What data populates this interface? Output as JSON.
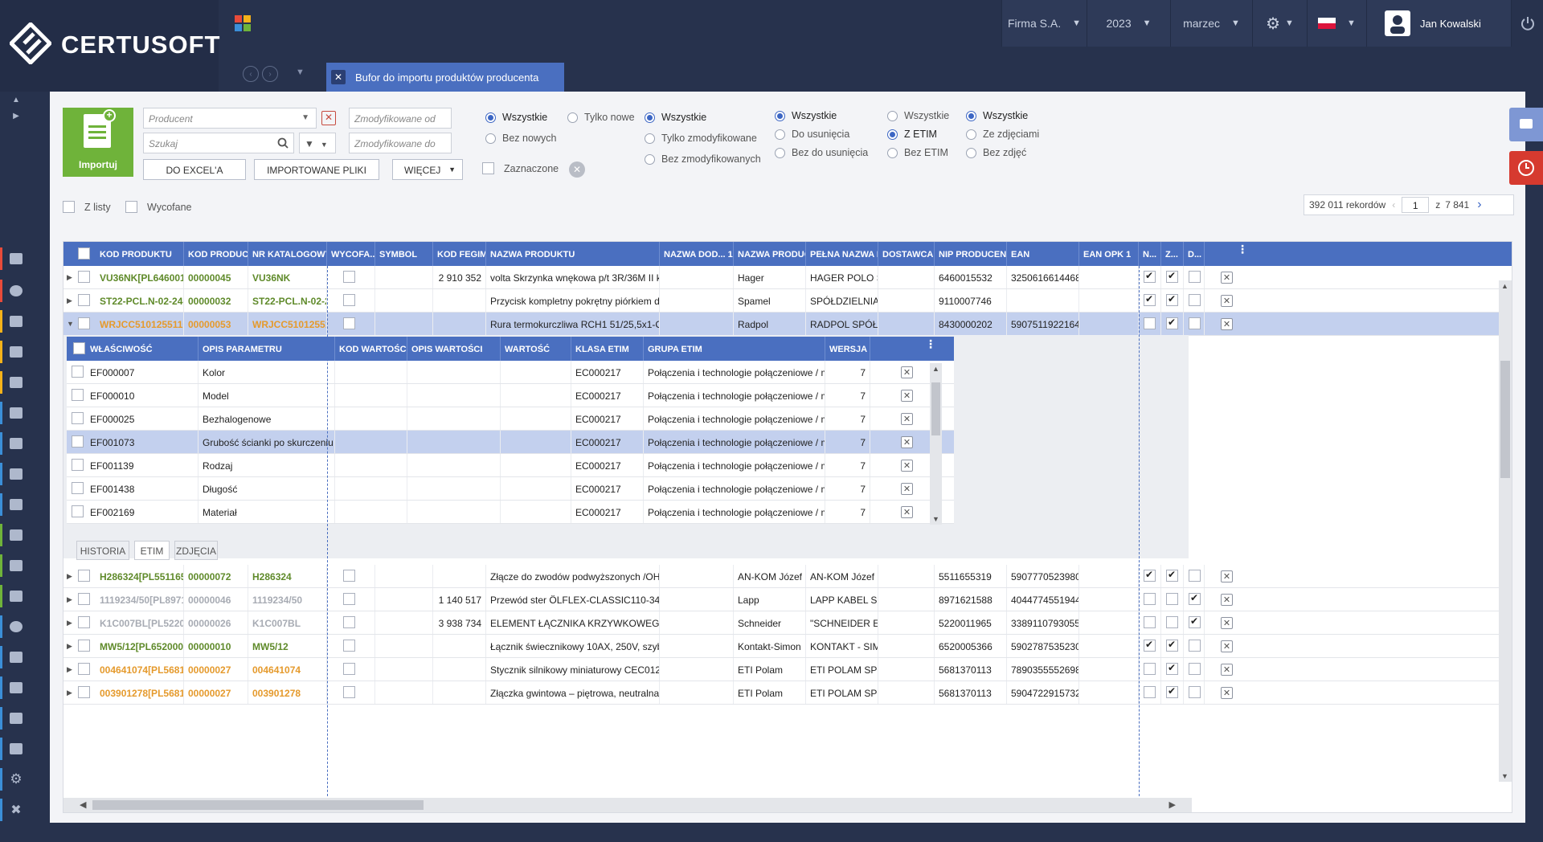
{
  "app": {
    "brand": "CERTUSOFT"
  },
  "topbar": {
    "company": "Firma S.A.",
    "year": "2023",
    "month": "marzec",
    "user": "Jan Kowalski"
  },
  "tab": {
    "title": "Bufor do importu produktów producenta"
  },
  "filters": {
    "import_label": "Importuj",
    "producer_placeholder": "Producent",
    "search_placeholder": "Szukaj",
    "modified_from_placeholder": "Zmodyfikowane od",
    "modified_to_placeholder": "Zmodyfikowane do",
    "btn_excel": "DO EXCEL'A",
    "btn_imported": "IMPORTOWANE PLIKI",
    "btn_more": "WIĘCEJ",
    "chk_marked": "Zaznaczone",
    "chk_from_list": "Z listy",
    "chk_withdrawn": "Wycofane",
    "group1": [
      "Wszystkie",
      "Bez nowych",
      "Tylko nowe"
    ],
    "group2": [
      "Wszystkie",
      "Tylko zmodyfikowane",
      "Bez zmodyfikowanych"
    ],
    "group3": [
      "Wszystkie",
      "Do usunięcia",
      "Bez do usunięcia"
    ],
    "group4": [
      "Wszystkie",
      "Z ETIM",
      "Bez ETIM"
    ],
    "group5": [
      "Wszystkie",
      "Ze zdjęciami",
      "Bez zdjęć"
    ]
  },
  "pager": {
    "records": "392 011 rekordów",
    "page": "1",
    "of": "z",
    "total": "7 841"
  },
  "grid": {
    "columns": [
      "KOD PRODUKTU",
      "KOD PRODUC...",
      "NR KATALOGOWY",
      "WYCOFA...",
      "SYMBOL",
      "KOD FEGIME",
      "NAZWA PRODUKTU",
      "NAZWA DOD... 1↑",
      "NAZWA PRODUC...",
      "PEŁNA NAZWA P...",
      "DOSTAWCA",
      "NIP PRODUCENTA",
      "EAN",
      "EAN OPK 1",
      "N...",
      "Z...",
      "D..."
    ],
    "rows_top": [
      {
        "kod": "VU36NK[PL6460015...",
        "kp": "00000045",
        "nr": "VU36NK",
        "fegime": "2 910 352",
        "nazwa": "volta Skrzynka wnękowa p/t 3R/36M II kl I...",
        "prod": "Hager",
        "pelna": "HAGER POLO S...",
        "nip": "6460015532",
        "ean": "3250616614468",
        "color": "green",
        "n": true,
        "z": true,
        "d": false
      },
      {
        "kod": "ST22-PCL.N-02-24-L...",
        "kp": "00000032",
        "nr": "ST22-PCL.N-02-2...",
        "fegime": "",
        "nazwa": "Przycisk kompletny pokrętny piórkiem dw...",
        "prod": "Spamel",
        "pelna": "SPÓŁDZIELNIA I...",
        "nip": "9110007746",
        "ean": "",
        "color": "green",
        "n": true,
        "z": true,
        "d": false
      },
      {
        "kod": "WRJCC51012551100...",
        "kp": "00000053",
        "nr": "WRJCC510125511...",
        "fegime": "",
        "nazwa": "Rura termokurczliwa RCH1 51/25,5x1-C",
        "prod": "Radpol",
        "pelna": "RADPOL SPÓŁK...",
        "nip": "8430000202",
        "ean": "5907511922164",
        "color": "orange",
        "n": false,
        "z": true,
        "d": false
      }
    ],
    "rows_bottom": [
      {
        "kod": "H286324[PL5511655...",
        "kp": "00000072",
        "nr": "H286324",
        "fegime": "",
        "nazwa": "Złącze do zwodów podwyższonych /OH/ P...",
        "prod": "AN-KOM Józef P...",
        "pelna": "AN-KOM Józef P...",
        "nip": "5511655319",
        "ean": "5907770523980",
        "color": "green",
        "n": true,
        "z": true,
        "d": false
      },
      {
        "kod": "1119234/50[PL8971...",
        "kp": "00000046",
        "nr": "1119234/50",
        "fegime": "1 140 517",
        "nazwa": "Przewód ster ÖLFLEX-CLASSIC110-34G1",
        "prod": "Lapp",
        "pelna": "LAPP KABEL SP...",
        "nip": "8971621588",
        "ean": "4044774551944",
        "color": "grey",
        "n": false,
        "z": false,
        "d": true
      },
      {
        "kod": "K1C007BL[PL522001...",
        "kp": "00000026",
        "nr": "K1C007BL",
        "fegime": "3 938 734",
        "nazwa": "ELEMENT ŁĄCZNIKA KRZYWKOWEGO",
        "prod": "Schneider",
        "pelna": "\"SCHNEIDER EL...",
        "nip": "5220011965",
        "ean": "3389110793055",
        "color": "grey",
        "n": false,
        "z": false,
        "d": true
      },
      {
        "kod": "MW5/12[PL6520005...",
        "kp": "00000010",
        "nr": "MW5/12",
        "fegime": "",
        "nazwa": "Łącznik świecznikowy 10AX, 250V, szybkoz...",
        "prod": "Kontakt-Simon",
        "pelna": "KONTAKT - SIM...",
        "nip": "6520005366",
        "ean": "5902787535230",
        "color": "green",
        "n": true,
        "z": true,
        "d": false
      },
      {
        "kod": "004641074[PL56813...",
        "kp": "00000027",
        "nr": "004641074",
        "fegime": "",
        "nazwa": "Stycznik silnikowy miniaturowy CEC012.10...",
        "prod": "ETI Polam",
        "pelna": "ETI POLAM SPÓ...",
        "nip": "5681370113",
        "ean": "7890355552698",
        "color": "orange",
        "n": false,
        "z": true,
        "d": false
      },
      {
        "kod": "003901278[PL56813...",
        "kp": "00000027",
        "nr": "003901278",
        "fegime": "",
        "nazwa": "Złączka gwintowa – piętrowa, neutralna 4 ...",
        "prod": "ETI Polam",
        "pelna": "ETI POLAM SPÓ...",
        "nip": "5681370113",
        "ean": "5904722915732",
        "color": "orange",
        "n": false,
        "z": true,
        "d": false
      }
    ]
  },
  "subgrid": {
    "columns": [
      "WŁAŚCIWOŚĆ",
      "OPIS PARAMETRU",
      "KOD WARTOŚCI",
      "OPIS WARTOŚCI",
      "WARTOŚĆ",
      "KLASA ETIM",
      "GRUPA ETIM",
      "WERSJA ..."
    ],
    "rows": [
      {
        "wl": "EF000007",
        "opis": "Kolor",
        "klasa": "EC000217",
        "grupa": "Połączenia i technologie połączeniowe / mat...",
        "wersja": "7"
      },
      {
        "wl": "EF000010",
        "opis": "Model",
        "klasa": "EC000217",
        "grupa": "Połączenia i technologie połączeniowe / mat...",
        "wersja": "7"
      },
      {
        "wl": "EF000025",
        "opis": "Bezhalogenowe",
        "klasa": "EC000217",
        "grupa": "Połączenia i technologie połączeniowe / mat...",
        "wersja": "7"
      },
      {
        "wl": "EF001073",
        "opis": "Grubość ścianki po skurczeniu",
        "klasa": "EC000217",
        "grupa": "Połączenia i technologie połączeniowe / mat...",
        "wersja": "7"
      },
      {
        "wl": "EF001139",
        "opis": "Rodzaj",
        "klasa": "EC000217",
        "grupa": "Połączenia i technologie połączeniowe / mat...",
        "wersja": "7"
      },
      {
        "wl": "EF001438",
        "opis": "Długość",
        "klasa": "EC000217",
        "grupa": "Połączenia i technologie połączeniowe / mat...",
        "wersja": "7"
      },
      {
        "wl": "EF002169",
        "opis": "Materiał",
        "klasa": "EC000217",
        "grupa": "Połączenia i technologie połączeniowe / mat...",
        "wersja": "7"
      }
    ],
    "tabs": [
      "HISTORIA",
      "ETIM",
      "ZDJĘCIA"
    ]
  },
  "colors": {
    "accent": "#4a6fc0",
    "import": "#6fb33a",
    "alert": "#d63a2f"
  }
}
